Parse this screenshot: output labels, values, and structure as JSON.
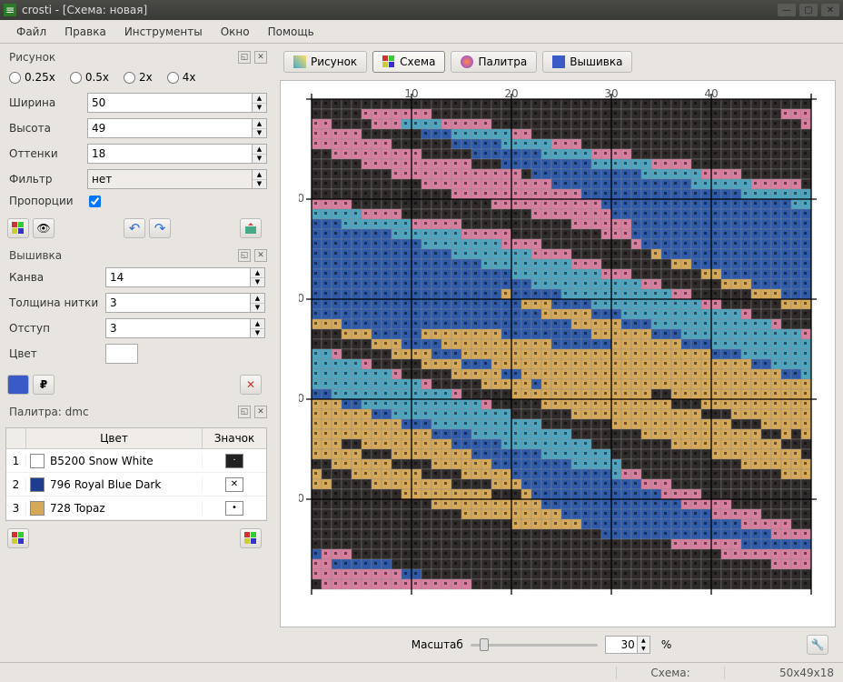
{
  "window": {
    "title": "crosti - [Схема: новая]"
  },
  "menu": {
    "file": "Файл",
    "edit": "Правка",
    "tools": "Инструменты",
    "window": "Окно",
    "help": "Помощь"
  },
  "panel_image": {
    "title": "Рисунок",
    "zoom_options": [
      "0.25x",
      "0.5x",
      "2x",
      "4x"
    ],
    "width_label": "Ширина",
    "width": "50",
    "height_label": "Высота",
    "height": "49",
    "shades_label": "Оттенки",
    "shades": "18",
    "filter_label": "Фильтр",
    "filter": "нет",
    "proportions_label": "Пропорции"
  },
  "panel_embroidery": {
    "title": "Вышивка",
    "canvas_label": "Канва",
    "canvas": "14",
    "thread_label": "Толщина нитки",
    "thread": "3",
    "padding_label": "Отступ",
    "padding": "3",
    "color_label": "Цвет"
  },
  "panel_palette": {
    "title": "Палитра: dmc",
    "hdr_color": "Цвет",
    "hdr_icon": "Значок",
    "rows": [
      {
        "n": "1",
        "swatch": "#ffffff",
        "name": "B5200 Snow White",
        "sym_bg": "#222",
        "sym": "·"
      },
      {
        "n": "2",
        "swatch": "#1e3d8f",
        "name": "796 Royal Blue Dark",
        "sym_bg": "#fff",
        "sym": "✕"
      },
      {
        "n": "3",
        "swatch": "#d6a85a",
        "name": "728 Topaz",
        "sym_bg": "#fff",
        "sym": "•"
      }
    ]
  },
  "tabs": {
    "image": "Рисунок",
    "scheme": "Схема",
    "palette": "Палитра",
    "embroidery": "Вышивка"
  },
  "zoom": {
    "label": "Масштаб",
    "value": "30",
    "pct": "%"
  },
  "status": {
    "scheme": "Схема:",
    "dims": "50x49x18"
  },
  "grid": {
    "cols": 50,
    "rows": 49,
    "colors": {
      "1": "#2f2a2a",
      "2": "#2e5aa8",
      "3": "#d6a85a",
      "4": "#d87fa0",
      "5": "#4fa4c0",
      "6": "#7a4d8a"
    },
    "cells": "1111111111111111111111111111111111111111111111111111111444444411111111111111111111111111111111111444441111444555544444111111111111111111111111111111144444411111122255555544111111111111111111111111111144444444111111222225555544411111111111111111111111114444444441111122222225555544441111111111111111111111144444444444111222222222555555444411111111111111111111444444444444412222222222255555544441111111111111111114444444444444222222222222225555554444411111111111111144444444444442222222222222222555555544441111111111111144444444444222222222222222222255555554444111111111111144444444222222222222222222222225555555444441111111111144444422222222222222222222222222555555544444111111111444222222222222222222222222222225555555544441111111114222222222222222222222222222222255555555444411111111322222222222222222222222222222222555555555444111111133222222222222222222222222222222225555555554441111111332222222222222222222222222222222555555555554411111133322222222222222222222222223222225555555555544111111333222222222222222222222222333222255555555555441111113332222222222222222222222233333222555555555555411111133322222222222222222222222333332225555555555554111111333222223333333322222222233333322255555555555541111113332222333333333332222223333333222555555555555411111333322233333333333333333333333332225555555555554111113333222333333333333333333333333332255555555555541111133333223333333333333333333333333322555555555555411111333332333333333333333333333333333225555555555554111113333333333333311333333333333333332255555555555541111133333333333331113333333333333333322555555555555111111333333333333311133333333333333333222555555555551111111333333333333111333333333333333332222555555555511111113333333333331131333311333333333222225555555551111111133333333333111333331113333333322222225555555111111111133333333311133333311113333332222222255555111111111111333333331113333333111133333222222222254411111111111111333331111333333331111333222222222222444111111111111111111111113333333331113222222222222244441111111111111111111111133333333333222222222222224444411111111111111111111111333333333322222222222222244444111111111111111111111111133333332222222222222222444441111111111111111111111111111111222222222222222224444111111111111111111111111111111111111444444422222222444111111111111111111111111111111111111144444444444222222111111111111111111111111111111111111114444444444444221111111111111111111111111111111111111111444444444444444111111111111111111111111111111111111111144444444444444411111111111111111111111111111111111111114444444444444441111111111111111111111111111111111111111444444444444444111111111111111"
  }
}
